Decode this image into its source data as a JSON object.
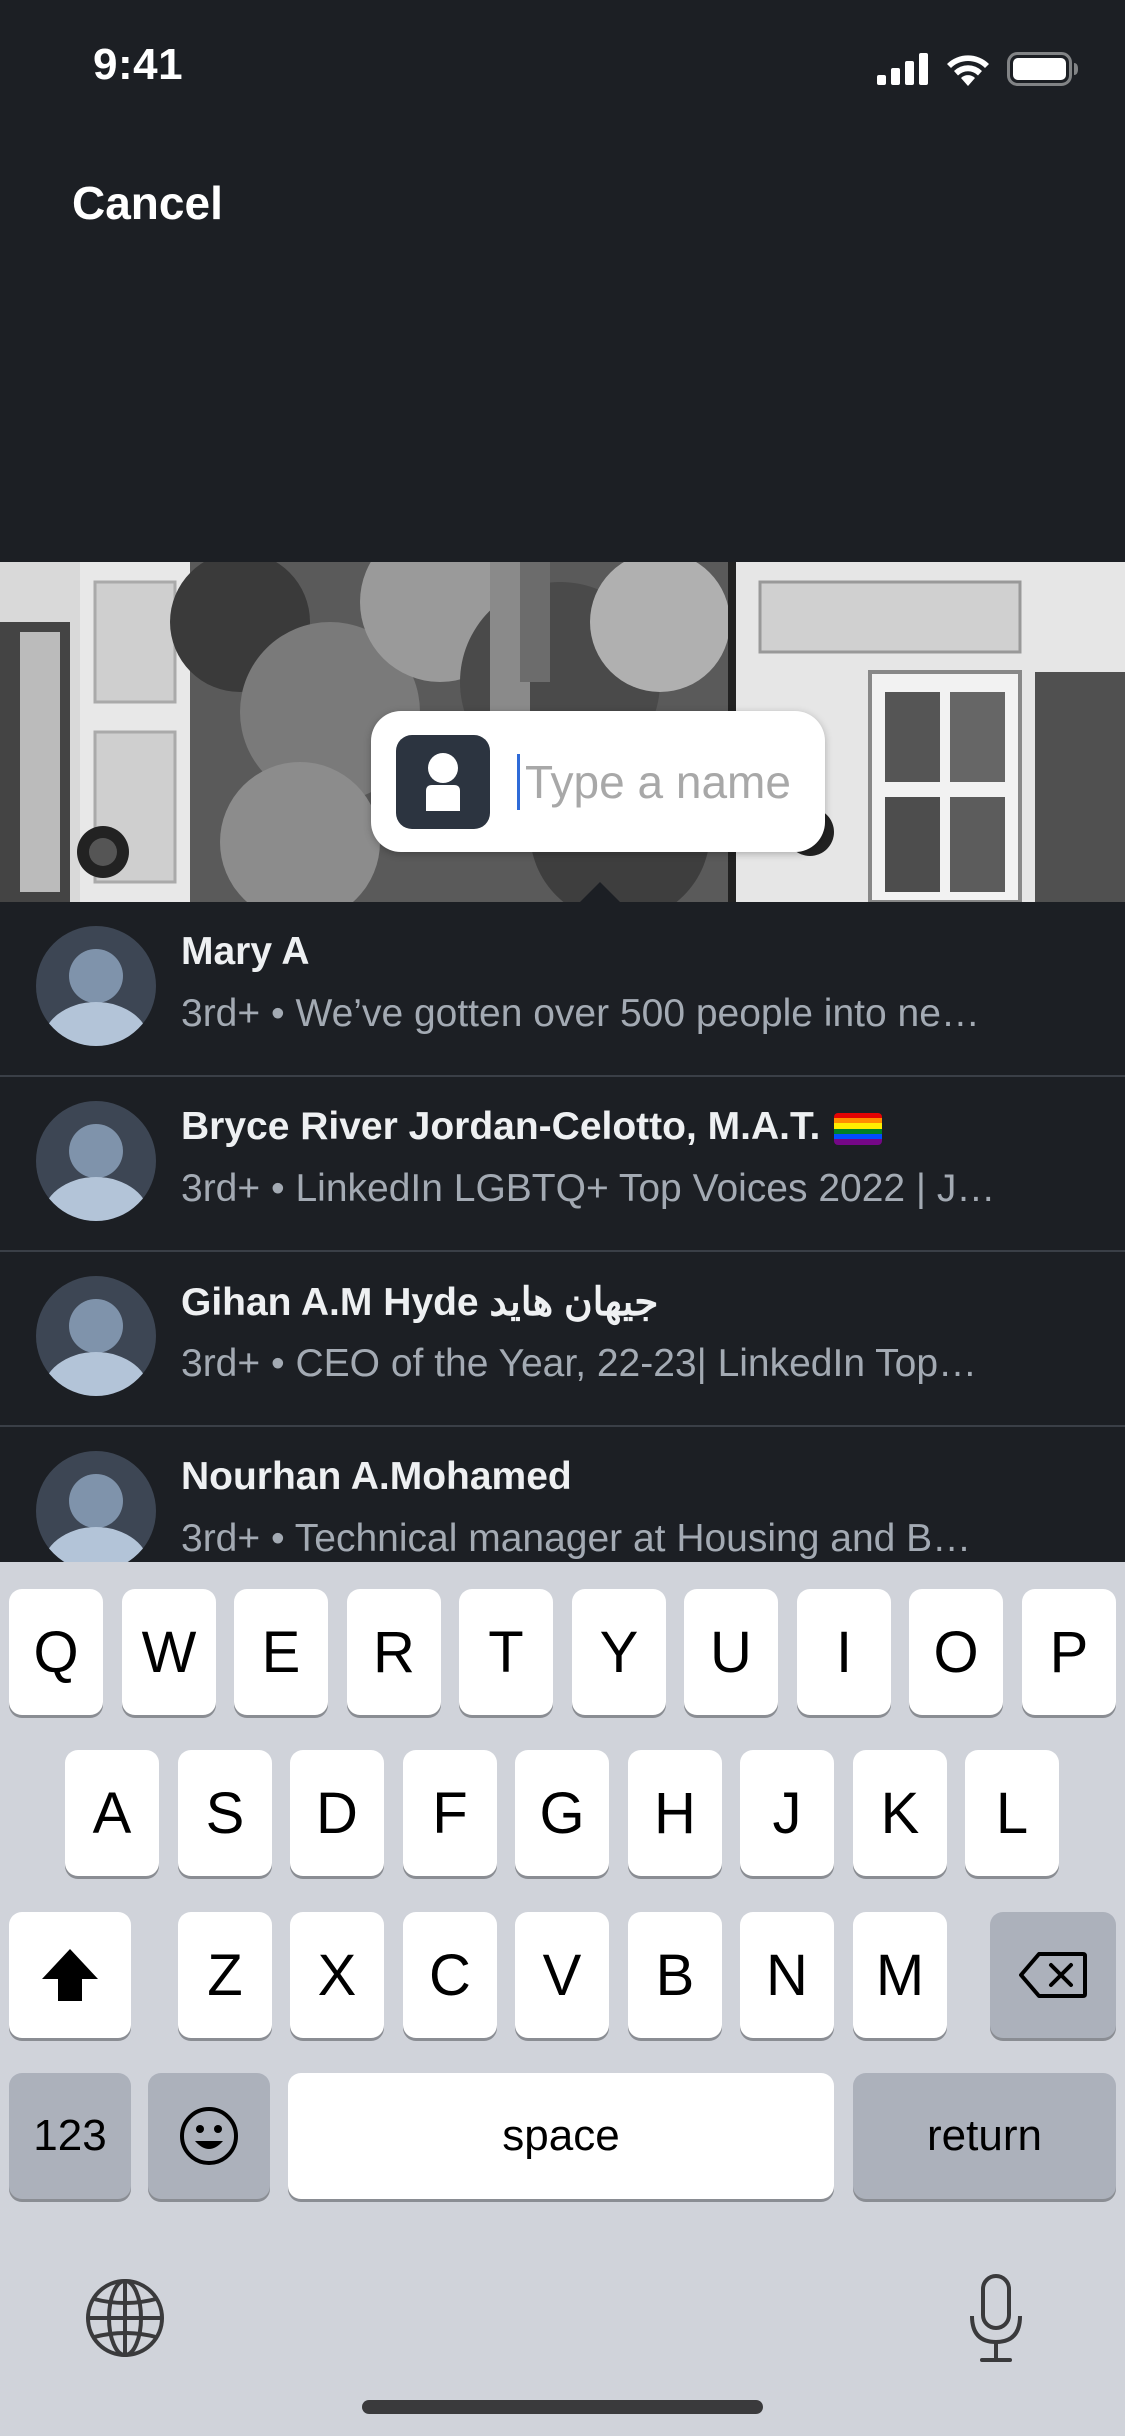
{
  "status_bar": {
    "time": "9:41"
  },
  "header": {
    "cancel_label": "Cancel"
  },
  "tag": {
    "placeholder": "Type a name",
    "value": ""
  },
  "results": [
    {
      "name": "Mary A",
      "degree": "3rd+",
      "headline": "We’ve gotten over 500 people into ne…",
      "flag": false
    },
    {
      "name": "Bryce River Jordan-Celotto, M.A.T.",
      "degree": "3rd+",
      "headline": "LinkedIn LGBTQ+ Top Voices 2022 | J…",
      "flag": true
    },
    {
      "name": "Gihan A.M Hyde جيهان هايد",
      "degree": "3rd+",
      "headline": "CEO of the Year, 22-23| LinkedIn Top…",
      "flag": false
    },
    {
      "name": "Nourhan A.Mohamed",
      "degree": "3rd+",
      "headline": "Technical manager at Housing and B…",
      "flag": false
    }
  ],
  "keyboard": {
    "row1": [
      "Q",
      "W",
      "E",
      "R",
      "T",
      "Y",
      "U",
      "I",
      "O",
      "P"
    ],
    "row2": [
      "A",
      "S",
      "D",
      "F",
      "G",
      "H",
      "J",
      "K",
      "L"
    ],
    "row3": [
      "Z",
      "X",
      "C",
      "V",
      "B",
      "N",
      "M"
    ],
    "numbers_label": "123",
    "space_label": "space",
    "return_label": "return"
  },
  "icons": [
    "cellular-signal-icon",
    "wifi-icon",
    "battery-icon",
    "person-icon",
    "shift-icon",
    "delete-icon",
    "emoji-icon",
    "globe-icon",
    "microphone-icon"
  ],
  "colors": {
    "background": "#1c1f24",
    "caret": "#2f6bd8",
    "keyboard": "#d0d3da",
    "flag": [
      "#e40303",
      "#ff8c00",
      "#ffed00",
      "#008026",
      "#004dff",
      "#750787"
    ]
  }
}
